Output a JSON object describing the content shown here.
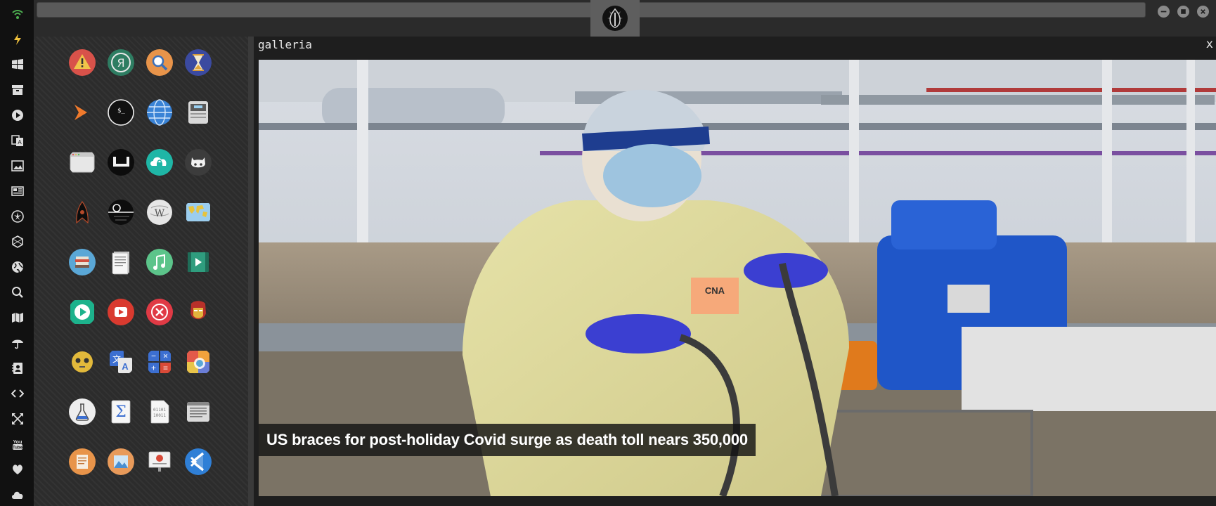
{
  "window": {
    "title": "galleria",
    "close_label": "x"
  },
  "news": {
    "headline": "US braces for post-holiday Covid surge as death toll nears 350,000"
  },
  "dock": {
    "icons": [
      "wifi-icon",
      "bolt-icon",
      "windows-icon",
      "archive-icon",
      "play-icon",
      "translate-icon",
      "image-icon",
      "newspaper-icon",
      "rebel-icon",
      "hexagon-icon",
      "globe-icon",
      "search-icon",
      "map-icon",
      "umbrella-icon",
      "contacts-icon",
      "code-icon",
      "expand-icon",
      "youtube-icon",
      "heart-icon",
      "cloud-icon"
    ]
  },
  "apps": [
    [
      "alert",
      "yandex",
      "magnifier",
      "hourglass"
    ],
    [
      "prompt",
      "terminal",
      "globe",
      "file-manager"
    ],
    [
      "browser-window",
      "steam-badge",
      "cloud-lock",
      "octocat"
    ],
    [
      "starfleet",
      "death-star",
      "wikipedia",
      "world-map"
    ],
    [
      "books",
      "document-stack",
      "music",
      "video"
    ],
    [
      "player",
      "youtube-red",
      "close-circle",
      "iron-man"
    ],
    [
      "c3po",
      "translate",
      "calculator",
      "color-picker"
    ],
    [
      "science",
      "sigma",
      "binary-file",
      "text-editor"
    ],
    [
      "office-doc",
      "image-viewer",
      "presentation",
      "vscode"
    ]
  ],
  "colors": {
    "dock_bg": "#111111",
    "panel_bg": "#2c2c2c",
    "accent_green": "#4caf50",
    "caption_bg": "#141414"
  }
}
